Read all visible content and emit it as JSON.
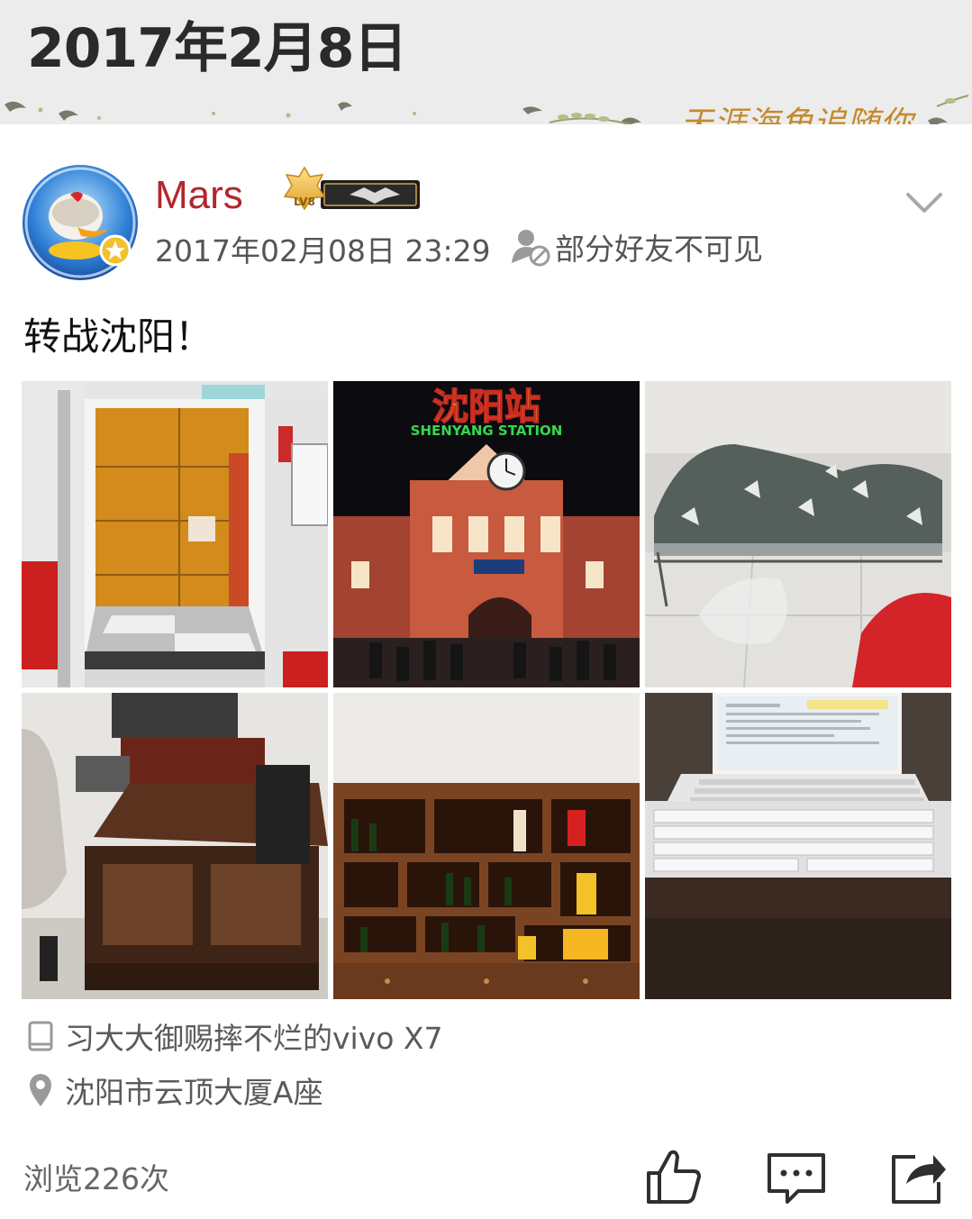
{
  "header": {
    "date_title": "2017年2月8日",
    "banner_text": "天涯海角追随你"
  },
  "post": {
    "username": "Mars",
    "vip_level": "LV8",
    "timestamp": "2017年02月08日 23:29",
    "visibility": "部分好友不可见",
    "text": "转战沈阳！",
    "photos": [
      {
        "icon": "photo-subway-door"
      },
      {
        "icon": "photo-station",
        "sign_cn": "沈阳站",
        "sign_en": "SHENYANG STATION"
      },
      {
        "icon": "photo-bed"
      },
      {
        "icon": "photo-desk"
      },
      {
        "icon": "photo-wine-shelf"
      },
      {
        "icon": "photo-laptop"
      }
    ],
    "device": "习大大御赐摔不烂的vivo X7",
    "location": "沈阳市云顶大厦A座",
    "views": "浏览226次"
  },
  "icons": {
    "device": "phone-icon",
    "location": "location-pin-icon",
    "like": "thumbs-up-icon",
    "comment": "comment-icon",
    "share": "share-icon",
    "more": "chevron-down-icon"
  },
  "colors": {
    "username": "#b3262d",
    "header_bg": "#ececec",
    "meta_text": "#5a5a5a",
    "banner": "#c48a2c"
  }
}
